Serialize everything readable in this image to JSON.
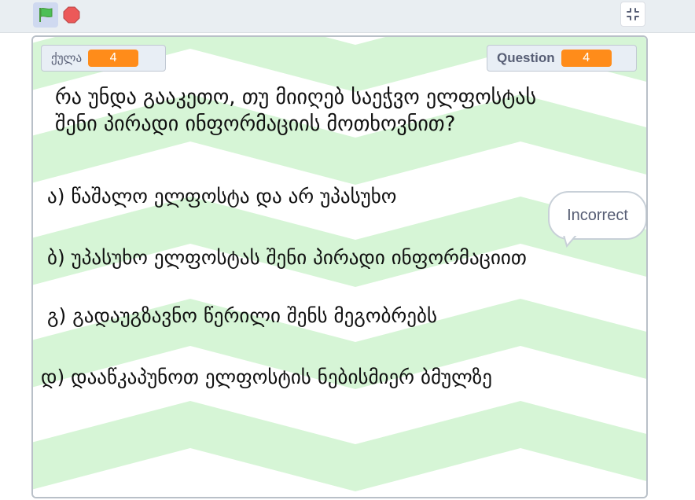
{
  "toolbar": {
    "green_flag_icon": "green-flag-icon",
    "stop_icon": "stop-icon",
    "fullscreen_icon": "exit-fullscreen-icon"
  },
  "monitors": {
    "score_label": "ქულა",
    "score_value": "4",
    "question_label": "Question",
    "question_value": "4"
  },
  "question": {
    "text": "რა უნდა გააკეთო, თუ მიიღებ საეჭვო ელფოსტას\nშენი პირადი ინფორმაციის მოთხოვნით?"
  },
  "answers": [
    "ა) წაშალო ელფოსტა და არ უპასუხო",
    "ბ) უპასუხო ელფოსტას შენი პირადი ინფორმაციით",
    "გ) გადაუგზავნო წერილი შენს მეგობრებს",
    "დ) დააწკაპუნოთ ელფოსტის ნებისმიერ ბმულზე"
  ],
  "speech_bubble": {
    "text": "Incorrect"
  },
  "colors": {
    "stage_stripe": "#d6f5d6",
    "monitor_value": "#ff8c1a",
    "green_flag": "#4cbf56",
    "stop": "#ec5959"
  }
}
